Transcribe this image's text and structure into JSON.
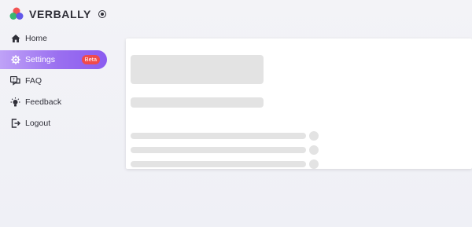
{
  "brand": {
    "name": "VERBALLY"
  },
  "nav": {
    "home": "Home",
    "settings": "Settings",
    "settings_badge": "Beta",
    "faq": "FAQ",
    "feedback": "Feedback",
    "logout": "Logout"
  },
  "icons": [
    "logo-icon",
    "status-dot-icon",
    "home-icon",
    "gear-icon",
    "faq-icon",
    "lightbulb-icon",
    "logout-icon"
  ],
  "colors": {
    "accent": "#9a6ff0",
    "badge": "#f14a4a",
    "skeleton": "#e3e3e3"
  }
}
